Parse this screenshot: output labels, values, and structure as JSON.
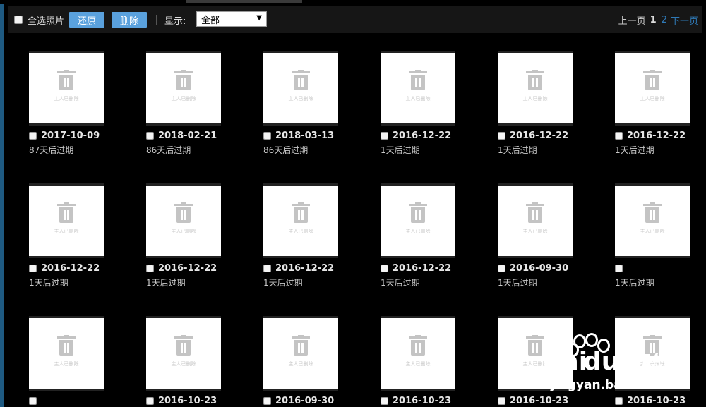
{
  "toolbar": {
    "select_all_label": "全选照片",
    "restore_label": "还原",
    "delete_label": "删除",
    "filter_label": "显示:",
    "filter_value": "全部",
    "filter_arrow": "▼"
  },
  "pager": {
    "prev": "上一页",
    "current": "1",
    "page2": "2",
    "next": "下一页"
  },
  "placeholder_text": "主人已删除",
  "photos": [
    {
      "date": "2017-10-09",
      "expire": "87天后过期"
    },
    {
      "date": "2018-02-21",
      "expire": "86天后过期"
    },
    {
      "date": "2018-03-13",
      "expire": "86天后过期"
    },
    {
      "date": "2016-12-22",
      "expire": "1天后过期"
    },
    {
      "date": "2016-12-22",
      "expire": "1天后过期"
    },
    {
      "date": "2016-12-22",
      "expire": "1天后过期"
    },
    {
      "date": "2016-12-22",
      "expire": "1天后过期"
    },
    {
      "date": "2016-12-22",
      "expire": "1天后过期"
    },
    {
      "date": "2016-12-22",
      "expire": "1天后过期"
    },
    {
      "date": "2016-12-22",
      "expire": "1天后过期"
    },
    {
      "date": "2016-09-30",
      "expire": "1天后过期"
    },
    {
      "date": "",
      "expire": "1天后过期"
    },
    {
      "date": "",
      "expire": ""
    },
    {
      "date": "2016-10-23",
      "expire": ""
    },
    {
      "date": "2016-09-30",
      "expire": ""
    },
    {
      "date": "2016-10-23",
      "expire": ""
    },
    {
      "date": "2016-10-23",
      "expire": ""
    },
    {
      "date": "2016-10-23",
      "expire": ""
    }
  ],
  "watermark": {
    "brand_left": "Bai",
    "brand_right": "du",
    "brand_cn": "经验",
    "url": "jingyan.baidu.com"
  }
}
